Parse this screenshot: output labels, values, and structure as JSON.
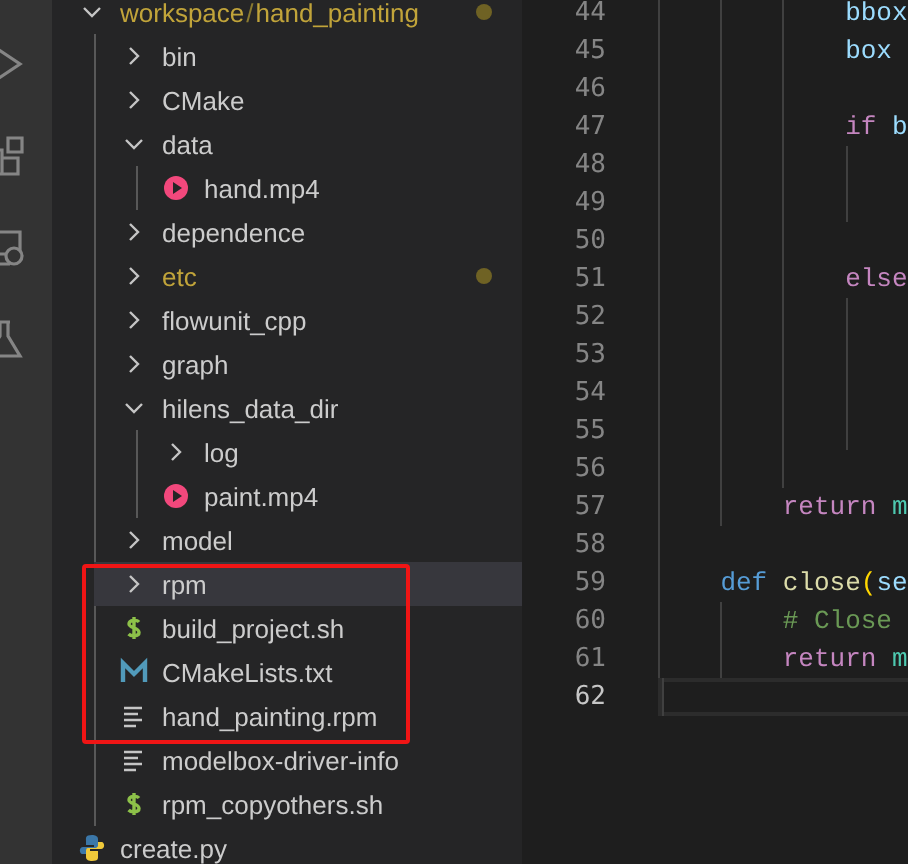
{
  "explorer": {
    "tree": [
      {
        "kind": "folder",
        "name": "workspace",
        "separator": "/",
        "subname": "hand_painting",
        "expanded": true,
        "selected": false,
        "modified": true,
        "children": [
          {
            "kind": "folder",
            "name": "bin",
            "expanded": false,
            "selected": false,
            "modified": false
          },
          {
            "kind": "folder",
            "name": "CMake",
            "expanded": false,
            "selected": false,
            "modified": false
          },
          {
            "kind": "folder",
            "name": "data",
            "expanded": true,
            "selected": false,
            "modified": false,
            "children": [
              {
                "kind": "video",
                "name": "hand.mp4",
                "selected": false,
                "modified": false
              }
            ]
          },
          {
            "kind": "folder",
            "name": "dependence",
            "expanded": false,
            "selected": false,
            "modified": false
          },
          {
            "kind": "folder",
            "name": "etc",
            "expanded": false,
            "selected": false,
            "modified": true
          },
          {
            "kind": "folder",
            "name": "flowunit_cpp",
            "expanded": false,
            "selected": false,
            "modified": false
          },
          {
            "kind": "folder",
            "name": "graph",
            "expanded": false,
            "selected": false,
            "modified": false
          },
          {
            "kind": "folder",
            "name": "hilens_data_dir",
            "expanded": true,
            "selected": false,
            "modified": false,
            "children": [
              {
                "kind": "folder",
                "name": "log",
                "expanded": false,
                "selected": false,
                "modified": false
              },
              {
                "kind": "video",
                "name": "paint.mp4",
                "selected": false,
                "modified": false
              }
            ]
          },
          {
            "kind": "folder",
            "name": "model",
            "expanded": false,
            "selected": false,
            "modified": false
          },
          {
            "kind": "folder",
            "name": "rpm",
            "expanded": false,
            "selected": true,
            "modified": false
          },
          {
            "kind": "shell",
            "name": "build_project.sh",
            "selected": false,
            "modified": false
          },
          {
            "kind": "cmake",
            "name": "CMakeLists.txt",
            "selected": false,
            "modified": false
          },
          {
            "kind": "text",
            "name": "hand_painting.rpm",
            "selected": false,
            "modified": false
          },
          {
            "kind": "text",
            "name": "modelbox-driver-info",
            "selected": false,
            "modified": false
          },
          {
            "kind": "shell",
            "name": "rpm_copyothers.sh",
            "selected": false,
            "modified": false
          }
        ]
      },
      {
        "kind": "python",
        "name": "create.py",
        "selected": false,
        "modified": false
      }
    ]
  },
  "editor": {
    "code": [
      {
        "children": [
          {
            "children": [
              {
                "children": [
                  {
                    "number": "44",
                    "current": false,
                    "tokens": [
                      {
                        "text": "bbox",
                        "kind": "variable"
                      }
                    ]
                  },
                  {
                    "number": "45",
                    "current": false,
                    "tokens": [
                      {
                        "text": "box",
                        "kind": "variable"
                      }
                    ]
                  },
                  {
                    "number": "46",
                    "current": false
                  },
                  {
                    "number": "47",
                    "current": false,
                    "tokens": [
                      {
                        "text": "if ",
                        "kind": "keyword"
                      },
                      {
                        "text": "b",
                        "kind": "variable"
                      }
                    ],
                    "children": [
                      {
                        "number": "48",
                        "current": false
                      },
                      {
                        "number": "49",
                        "current": false
                      }
                    ]
                  },
                  {
                    "number": "50",
                    "current": false
                  },
                  {
                    "number": "51",
                    "current": false,
                    "tokens": [
                      {
                        "text": "else",
                        "kind": "keyword"
                      }
                    ],
                    "children": [
                      {
                        "number": "52",
                        "current": false
                      },
                      {
                        "number": "53",
                        "current": false
                      },
                      {
                        "number": "54",
                        "current": false
                      },
                      {
                        "number": "55",
                        "current": false
                      }
                    ]
                  },
                  {
                    "number": "56",
                    "current": false
                  }
                ]
              },
              {
                "number": "57",
                "current": false,
                "tokens": [
                  {
                    "text": "return ",
                    "kind": "keyword"
                  },
                  {
                    "text": "m",
                    "kind": "module"
                  }
                ]
              }
            ]
          },
          {
            "number": "58",
            "current": false
          },
          {
            "number": "59",
            "current": false,
            "tokens": [
              {
                "text": "def ",
                "kind": "storage"
              },
              {
                "text": "close",
                "kind": "function"
              },
              {
                "text": "(",
                "kind": "paren"
              },
              {
                "text": "se",
                "kind": "variable"
              }
            ],
            "children": [
              {
                "number": "60",
                "current": false,
                "tokens": [
                  {
                    "text": "# Close",
                    "kind": "comment"
                  }
                ]
              },
              {
                "number": "61",
                "current": false,
                "tokens": [
                  {
                    "text": "return ",
                    "kind": "keyword"
                  },
                  {
                    "text": "m",
                    "kind": "module"
                  }
                ]
              }
            ]
          },
          {
            "number": "62",
            "current": true
          }
        ]
      }
    ]
  },
  "annotation": {
    "kind": "frame"
  }
}
